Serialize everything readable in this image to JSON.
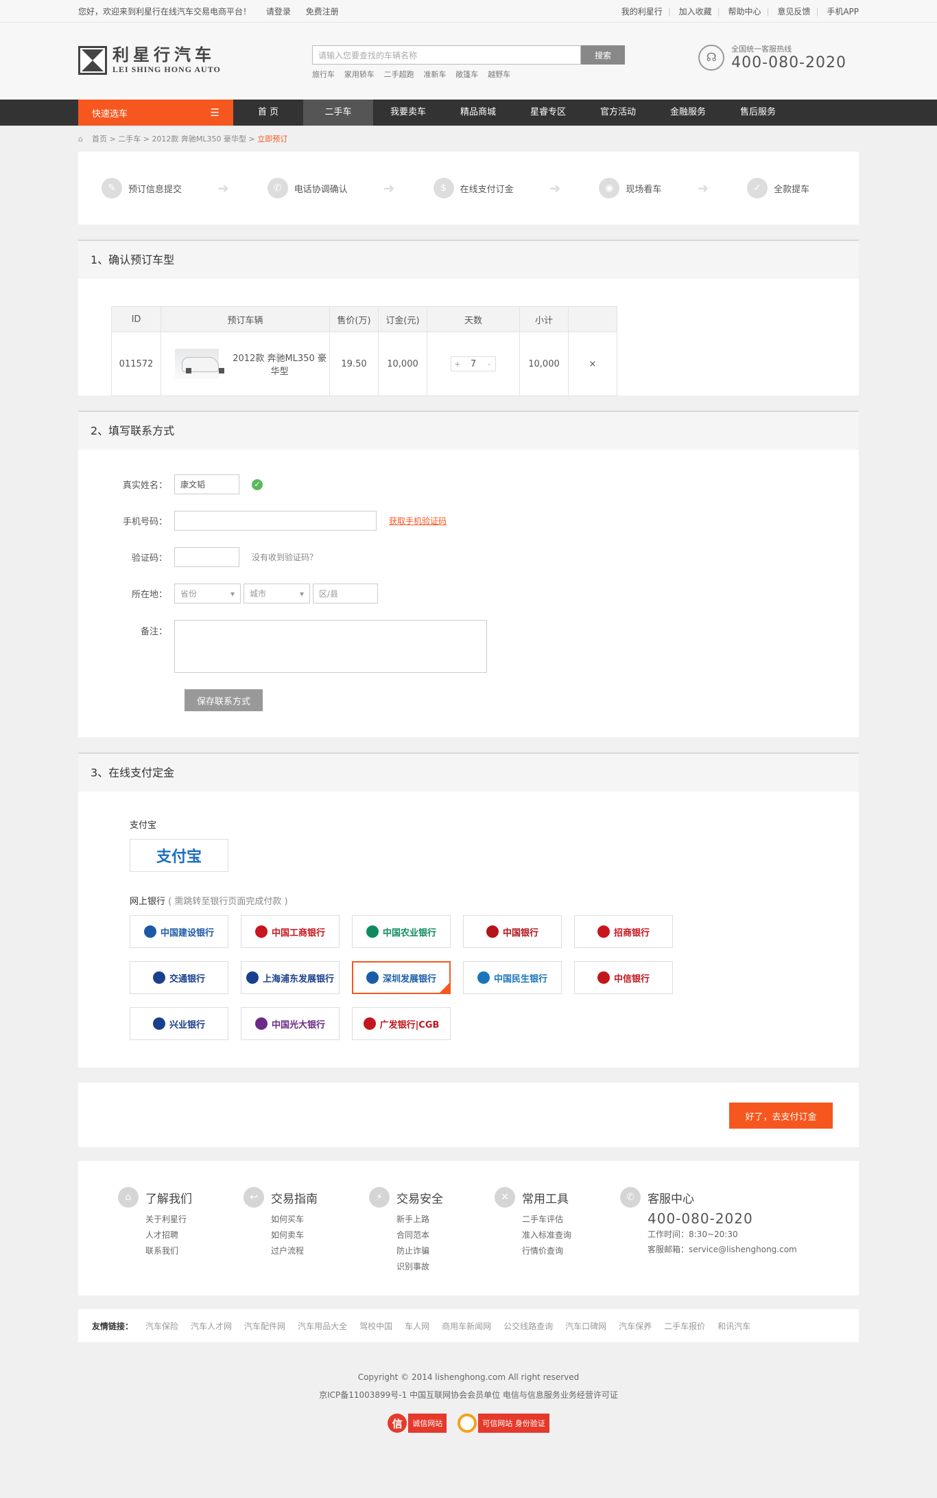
{
  "topbar": {
    "welcome": "您好，欢迎来到利星行在线汽车交易电商平台！",
    "login": "请登录",
    "register": "免费注册",
    "links": [
      "我的利星行",
      "加入收藏",
      "帮助中心",
      "意见反馈",
      "手机APP"
    ]
  },
  "header": {
    "logo_cn": "利星行汽车",
    "logo_en": "LEI SHING HONG AUTO",
    "search_placeholder": "请输入您要查找的车辆名称",
    "search_btn": "搜索",
    "hot": [
      "旅行车",
      "家用轿车",
      "二手超跑",
      "准新车",
      "敞篷车",
      "越野车"
    ],
    "hotline_label": "全国统一客服热线",
    "hotline_num": "400-080-2020"
  },
  "nav": {
    "quick": "快速选车",
    "items": [
      "首 页",
      "二手车",
      "我要卖车",
      "精品商城",
      "星睿专区",
      "官方活动",
      "金融服务",
      "售后服务"
    ]
  },
  "breadcrumb": [
    "首页",
    "二手车",
    "2012款 奔驰ML350 豪华型",
    "立即预订"
  ],
  "steps": [
    "预订信息提交",
    "电话协调确认",
    "在线支付订金",
    "现场看车",
    "全款提车"
  ],
  "section1": {
    "title": "1、确认预订车型",
    "headers": [
      "ID",
      "预订车辆",
      "售价(万)",
      "订金(元)",
      "天数",
      "小计",
      ""
    ],
    "row": {
      "id": "011572",
      "car": "2012款 奔驰ML350 豪华型",
      "price": "19.50",
      "deposit": "10,000",
      "days": "7",
      "subtotal": "10,000",
      "remove": "×"
    }
  },
  "section2": {
    "title": "2、填写联系方式",
    "name_label": "真实姓名：",
    "name_value": "康文韬",
    "phone_label": "手机号码：",
    "get_code": "获取手机验证码",
    "code_label": "验证码：",
    "code_hint": "没有收到验证码？",
    "region_label": "所在地：",
    "province": "省份",
    "city": "城市",
    "district": "区/县",
    "remark_label": "备注：",
    "save": "保存联系方式"
  },
  "section3": {
    "title": "3、在线支付定金",
    "alipay_label": "支付宝",
    "alipay_logo": "支付宝",
    "bank_label": "网上银行",
    "bank_note": "( 需跳转至银行页面完成付款 )",
    "banks": [
      {
        "name": "中国建设银行",
        "color": "#1d5aa6"
      },
      {
        "name": "中国工商银行",
        "color": "#c7161e"
      },
      {
        "name": "中国农业银行",
        "color": "#0f8a5f"
      },
      {
        "name": "中国银行",
        "color": "#b3131a"
      },
      {
        "name": "招商银行",
        "color": "#c8151d"
      },
      {
        "name": "交通银行",
        "color": "#1a3f8c"
      },
      {
        "name": "上海浦东发展银行",
        "color": "#1a3f8c"
      },
      {
        "name": "深圳发展银行",
        "color": "#1a5ca8"
      },
      {
        "name": "中国民生银行",
        "color": "#1a75bb"
      },
      {
        "name": "中信银行",
        "color": "#c3161d"
      },
      {
        "name": "兴业银行",
        "color": "#1a3f8c"
      },
      {
        "name": "中国光大银行",
        "color": "#6a2b86"
      },
      {
        "name": "广发银行|CGB",
        "color": "#c3161d"
      }
    ]
  },
  "submit": "好了，去支付订金",
  "footer": {
    "cols": [
      {
        "title": "了解我们",
        "icon": "home-icon",
        "links": [
          "关于利星行",
          "人才招聘",
          "联系我们"
        ]
      },
      {
        "title": "交易指南",
        "icon": "arrow-icon",
        "links": [
          "如何买车",
          "如何卖车",
          "过户流程"
        ]
      },
      {
        "title": "交易安全",
        "icon": "lightning-icon",
        "links": [
          "新手上路",
          "合同范本",
          "防止诈骗",
          "识别事故"
        ]
      },
      {
        "title": "常用工具",
        "icon": "tools-icon",
        "links": [
          "二手车评估",
          "准入标准查询",
          "行情价查询"
        ]
      }
    ],
    "cs_title": "客服中心",
    "cs_num": "400-080-2020",
    "cs_hours": "工作时间：8:30~20:30",
    "cs_email": "客服邮箱：service@lishenghong.com"
  },
  "friend": {
    "label": "友情链接：",
    "links": [
      "汽车保险",
      "汽车人才网",
      "汽车配件网",
      "汽车用品大全",
      "驾校中国",
      "车人网",
      "商用车新闻网",
      "公交线路查询",
      "汽车口碑网",
      "汽车保养",
      "二手车报价",
      "和讯汽车"
    ]
  },
  "copyright": "Copyright © 2014  lishenghong.com   All right reserved",
  "icp": "京ICP备11003899号-1    中国互联网协会会员单位    电信与信息服务业务经营许可证",
  "badges": {
    "a": "诚信网站",
    "b": "可信网站 身份验证"
  }
}
